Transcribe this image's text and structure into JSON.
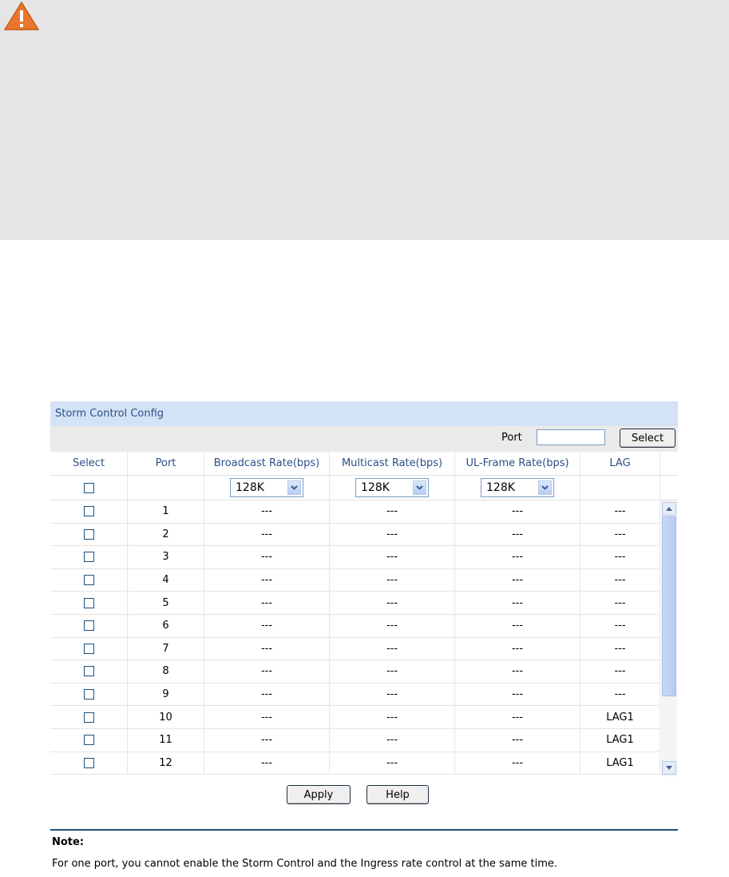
{
  "warning": {
    "icon": "warning-icon",
    "accent": "#e8772e"
  },
  "panel": {
    "title": "Storm Control Config",
    "search": {
      "label": "Port",
      "value": "",
      "button": "Select"
    },
    "columns": [
      "Select",
      "Port",
      "Broadcast Rate(bps)",
      "Multicast Rate(bps)",
      "UL-Frame Rate(bps)",
      "LAG"
    ],
    "filter": {
      "broadcast": "128K",
      "multicast": "128K",
      "ul_frame": "128K"
    },
    "rows": [
      {
        "port": "1",
        "broadcast": "---",
        "multicast": "---",
        "ul_frame": "---",
        "lag": "---"
      },
      {
        "port": "2",
        "broadcast": "---",
        "multicast": "---",
        "ul_frame": "---",
        "lag": "---"
      },
      {
        "port": "3",
        "broadcast": "---",
        "multicast": "---",
        "ul_frame": "---",
        "lag": "---"
      },
      {
        "port": "4",
        "broadcast": "---",
        "multicast": "---",
        "ul_frame": "---",
        "lag": "---"
      },
      {
        "port": "5",
        "broadcast": "---",
        "multicast": "---",
        "ul_frame": "---",
        "lag": "---"
      },
      {
        "port": "6",
        "broadcast": "---",
        "multicast": "---",
        "ul_frame": "---",
        "lag": "---"
      },
      {
        "port": "7",
        "broadcast": "---",
        "multicast": "---",
        "ul_frame": "---",
        "lag": "---"
      },
      {
        "port": "8",
        "broadcast": "---",
        "multicast": "---",
        "ul_frame": "---",
        "lag": "---"
      },
      {
        "port": "9",
        "broadcast": "---",
        "multicast": "---",
        "ul_frame": "---",
        "lag": "---"
      },
      {
        "port": "10",
        "broadcast": "---",
        "multicast": "---",
        "ul_frame": "---",
        "lag": "LAG1"
      },
      {
        "port": "11",
        "broadcast": "---",
        "multicast": "---",
        "ul_frame": "---",
        "lag": "LAG1"
      },
      {
        "port": "12",
        "broadcast": "---",
        "multicast": "---",
        "ul_frame": "---",
        "lag": "LAG1"
      }
    ],
    "actions": {
      "apply": "Apply",
      "help": "Help"
    }
  },
  "note": {
    "title": "Note:",
    "text": "For one port, you cannot enable the Storm Control and the Ingress rate control at the same time."
  }
}
